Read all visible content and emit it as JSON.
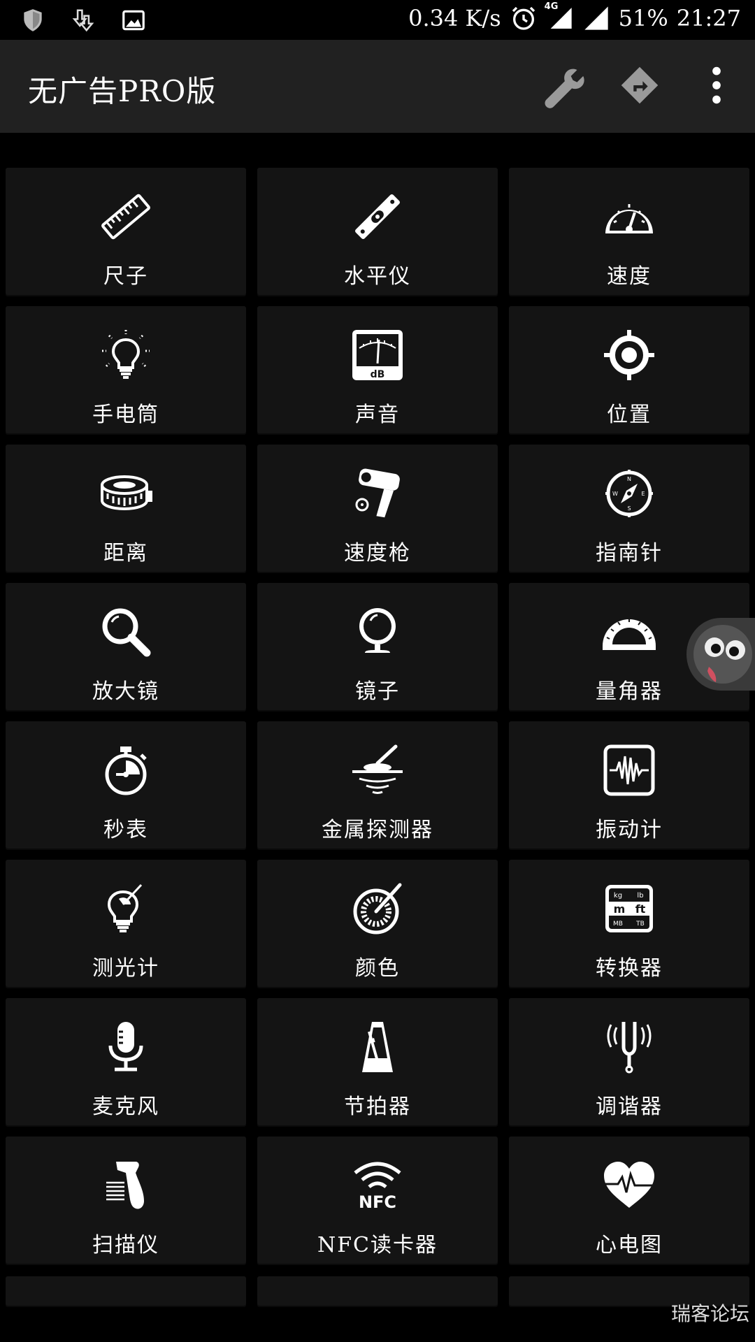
{
  "status_bar": {
    "net_speed": "0.34 K/s",
    "network_type": "4G",
    "battery": "51%",
    "time": "21:27"
  },
  "app_bar": {
    "title": "无广告PRO版"
  },
  "tools": [
    {
      "label": "尺子",
      "icon": "ruler-icon"
    },
    {
      "label": "水平仪",
      "icon": "spirit-level-icon"
    },
    {
      "label": "速度",
      "icon": "speedometer-icon"
    },
    {
      "label": "手电筒",
      "icon": "lightbulb-icon"
    },
    {
      "label": "声音",
      "icon": "db-meter-icon"
    },
    {
      "label": "位置",
      "icon": "location-target-icon"
    },
    {
      "label": "距离",
      "icon": "tape-measure-icon"
    },
    {
      "label": "速度枪",
      "icon": "radar-gun-icon"
    },
    {
      "label": "指南针",
      "icon": "compass-icon"
    },
    {
      "label": "放大镜",
      "icon": "magnifier-icon"
    },
    {
      "label": "镜子",
      "icon": "mirror-icon"
    },
    {
      "label": "量角器",
      "icon": "protractor-icon"
    },
    {
      "label": "秒表",
      "icon": "stopwatch-icon"
    },
    {
      "label": "金属探测器",
      "icon": "metal-detector-icon"
    },
    {
      "label": "振动计",
      "icon": "vibration-meter-icon"
    },
    {
      "label": "测光计",
      "icon": "light-meter-icon"
    },
    {
      "label": "颜色",
      "icon": "color-picker-icon"
    },
    {
      "label": "转换器",
      "icon": "unit-converter-icon"
    },
    {
      "label": "麦克风",
      "icon": "microphone-icon"
    },
    {
      "label": "节拍器",
      "icon": "metronome-icon"
    },
    {
      "label": "调谐器",
      "icon": "tuning-fork-icon"
    },
    {
      "label": "扫描仪",
      "icon": "barcode-scanner-icon"
    },
    {
      "label": "NFC读卡器",
      "icon": "nfc-icon"
    },
    {
      "label": "心电图",
      "icon": "heart-rate-icon"
    }
  ],
  "watermark": "瑞客论坛"
}
